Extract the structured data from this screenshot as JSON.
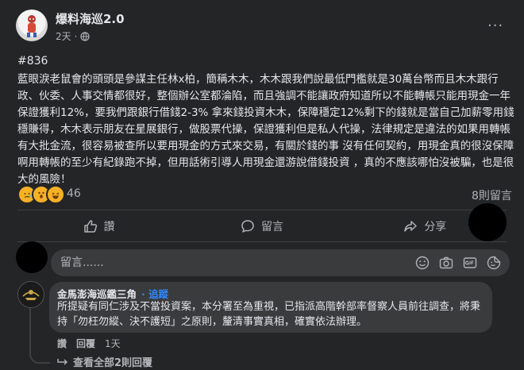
{
  "post": {
    "page_name": "爆料海巡2.0",
    "time": "2天",
    "audience_icon": "globe-icon",
    "tag": "#836",
    "body": "藍眼淚老鼠會的頭頭是參謀主任林x柏，簡稱木木，木木跟我們說最低門檻就是30萬台幣而且木木跟行政、伙委、人事交情都很好，整個辦公室都淪陷，而且強調不能讓政府知道所以不能轉帳只能用現金一年保證獲利12%，要我們跟銀行借錢2-3% 拿來錢投資木木，保障穩定12%剩下的錢就是當自己加薪零用錢穩賺得，木木表示朋友在星展銀行，做股票代操，保證獲利但是私人代操，法律規定是違法的如果用轉帳有大批金流，很容易被查所以要用現金的方式來交易，有關於錢的事 沒有任何契約，用現金真的很沒保障啊用轉帳的至少有紀錄跑不掉，但用話術引導人用現金還游說借錢投資 ，真的不應該哪怕沒被騙，也是很大的風險！",
    "reaction_count": "46",
    "reactions": [
      "sad-reaction-icon",
      "wow-reaction-icon",
      "haha-reaction-icon"
    ],
    "comment_count": "8則留言"
  },
  "actions": {
    "like": "讚",
    "comment": "留言",
    "share": "分享"
  },
  "comment_box": {
    "placeholder": "留言......",
    "icons": [
      "emoji-icon",
      "camera-icon",
      "gif-icon",
      "sticker-icon"
    ]
  },
  "reply": {
    "author": "金馬澎海巡鑑三角",
    "follow": "· 追蹤",
    "text": "所提疑有同仁涉及不當投資案，本分署至為重視，已指派高階幹部率督察人員前往調查，將秉持「勿枉勿縱、決不護短」之原則，釐清事實真相，確實依法辦理。",
    "like": "讚",
    "reply_label": "回覆",
    "time": "1天"
  },
  "view_replies": "查看全部2則回覆",
  "colors": {
    "background": "#242526",
    "bubble": "#3a3b3c",
    "text": "#e4e6eb",
    "secondary": "#b0b3b8",
    "link": "#2d88ff"
  }
}
